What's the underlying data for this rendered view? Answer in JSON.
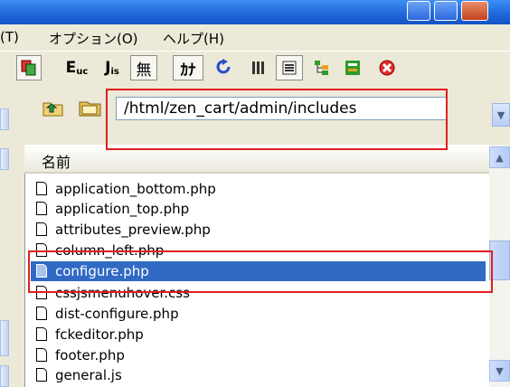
{
  "menu": {
    "item_partial": "(T)",
    "options": "オプション(O)",
    "help": "ヘルプ(H)"
  },
  "toolbar": {
    "btn_e": "E",
    "btn_e_sub": "uc",
    "btn_j": "J",
    "btn_j_sub": "is",
    "btn_mu": "無",
    "btn_ka": "ｶﾅ"
  },
  "address": {
    "path": "/html/zen_cart/admin/includes"
  },
  "filelist": {
    "header": "名前",
    "files": [
      "application_bottom.php",
      "application_top.php",
      "attributes_preview.php",
      "column_left.php",
      "configure.php",
      "cssjsmenuhover.css",
      "dist-configure.php",
      "fckeditor.php",
      "footer.php",
      "general.js"
    ],
    "selected": "configure.php"
  },
  "colors": {
    "selection": "#316ac5",
    "highlight_box": "#e02020",
    "titlebar": "#1e66d8"
  }
}
